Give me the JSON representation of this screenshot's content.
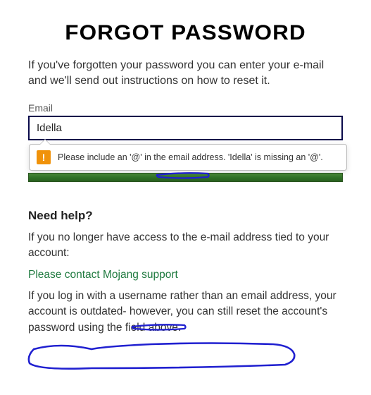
{
  "title": "FORGOT PASSWORD",
  "instructions": "If you've forgotten your password you can enter your e-mail and we'll send out instructions on how to reset it.",
  "form": {
    "email_label": "Email",
    "email_value": "Idella"
  },
  "validation": {
    "message": "Please include an '@' in the email address. 'Idella' is missing an '@'."
  },
  "help": {
    "title": "Need help?",
    "no_access_text": "If you no longer have access to the e-mail address tied to your account:",
    "support_link_text": "Please contact Mojang support",
    "outdated_text": "If you log in with a username rather than an email address, your account is outdated- however, you can still reset the account's password using the field above."
  }
}
